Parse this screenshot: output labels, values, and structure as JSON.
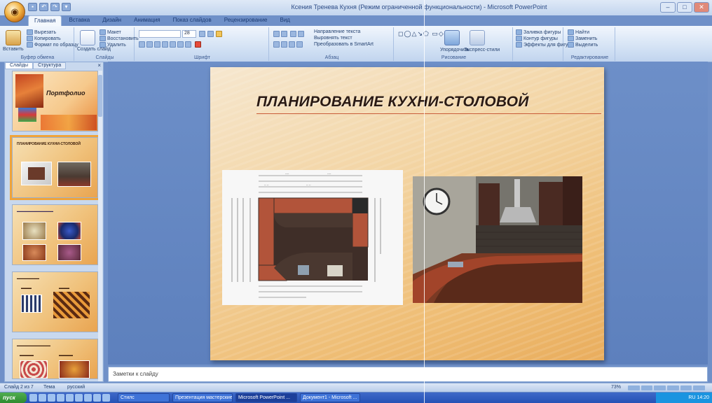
{
  "window": {
    "title": "Ксения Тренева Кухня (Режим ограниченной функциональности) - Microsoft PowerPoint",
    "controls": [
      "–",
      "□",
      "✕"
    ]
  },
  "ribbon": {
    "tabs": [
      "Главная",
      "Вставка",
      "Дизайн",
      "Анимация",
      "Показ слайдов",
      "Рецензирование",
      "Вид"
    ],
    "active_tab": "Главная",
    "clipboard": {
      "paste": "Вставить",
      "cut": "Вырезать",
      "copy": "Копировать",
      "format": "Формат по образцу",
      "label": "Буфер обмена"
    },
    "slides": {
      "new": "Создать слайд",
      "layout": "Макет",
      "reset": "Восстановить",
      "delete": "Удалить",
      "label": "Слайды"
    },
    "font": {
      "size": "28",
      "label": "Шрифт"
    },
    "paragraph": {
      "label": "Абзац",
      "direction": "Направление текста",
      "align": "Выровнять текст",
      "smartart": "Преобразовать в SmartArt"
    },
    "drawing": {
      "arrange": "Упорядочить",
      "styles": "Экспресс-стили",
      "fill": "Заливка фигуры",
      "outline": "Контур фигуры",
      "effects": "Эффекты для фигур",
      "label": "Рисование"
    },
    "editing": {
      "find": "Найти",
      "replace": "Заменить",
      "select": "Выделить",
      "label": "Редактирование"
    }
  },
  "panel": {
    "tabs": [
      "Слайды",
      "Структура"
    ],
    "close": "×",
    "thumbs": [
      {
        "title": "Портфолио"
      },
      {
        "title": "ПЛАНИРОВАНИЕ КУХНИ-СТОЛОВОЙ"
      },
      {
        "title": ""
      },
      {
        "title": ""
      },
      {
        "title": ""
      }
    ]
  },
  "slide": {
    "title": "ПЛАНИРОВАНИЕ КУХНИ-СТОЛОВОЙ"
  },
  "notes": {
    "placeholder": "Заметки к слайду"
  },
  "status": {
    "slide": "Слайд 2 из 7",
    "theme": "Тема",
    "lang": "русский",
    "zoom": "73%"
  },
  "taskbar": {
    "start": "пуск",
    "items": [
      "Стилс",
      "Презентация мастерские...",
      "Microsoft PowerPoint ...",
      "Документ1 - Microsoft ..."
    ],
    "active_index": 2,
    "clock": "RU 14:20"
  },
  "colors": {
    "accent": "#f0a43a",
    "slide_bg": "#f3d4a2",
    "title_rule": "#c95c3a"
  }
}
